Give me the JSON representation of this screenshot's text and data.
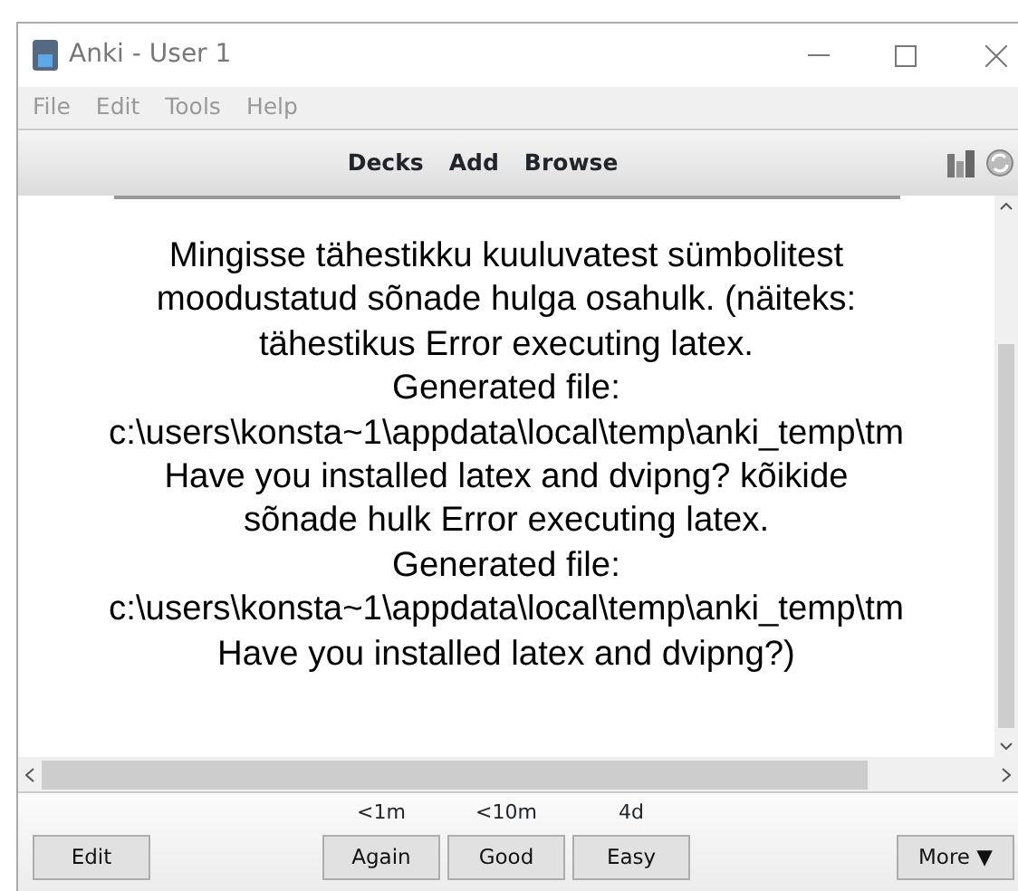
{
  "window": {
    "title": "Anki - User 1"
  },
  "menu": [
    "File",
    "Edit",
    "Tools",
    "Help"
  ],
  "toolbar": {
    "links": [
      "Decks",
      "Add",
      "Browse"
    ]
  },
  "card_lines": [
    "Mingisse tähestikku kuuluvatest sümbolitest",
    "moodustatud sõnade hulga osahulk. (näiteks:",
    "tähestikus Error executing latex.",
    "Generated file:",
    "c:\\users\\konsta~1\\appdata\\local\\temp\\anki_temp\\tm",
    "Have you installed latex and dvipng? kõikide",
    "sõnade hulk Error executing latex.",
    "Generated file:",
    "c:\\users\\konsta~1\\appdata\\local\\temp\\anki_temp\\tm",
    "Have you installed latex and dvipng?)"
  ],
  "bottom": {
    "edit": "Edit",
    "answers": [
      {
        "interval": "<1m",
        "label": "Again"
      },
      {
        "interval": "<10m",
        "label": "Good"
      },
      {
        "interval": "4d",
        "label": "Easy"
      }
    ],
    "more": "More ▼"
  }
}
